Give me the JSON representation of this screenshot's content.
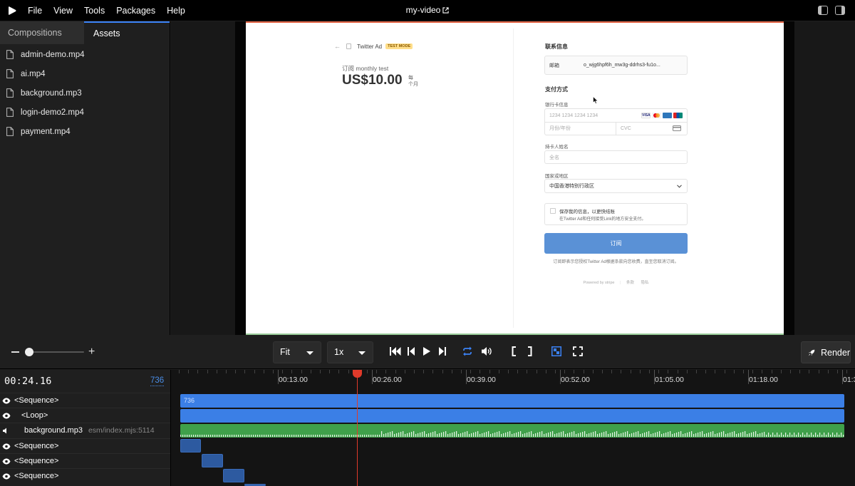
{
  "menubar": {
    "items": [
      "File",
      "View",
      "Tools",
      "Packages",
      "Help"
    ],
    "title": "my-video"
  },
  "sidebar": {
    "tabs": [
      "Compositions",
      "Assets"
    ],
    "assets": [
      "admin-demo.mp4",
      "ai.mp4",
      "background.mp3",
      "login-demo2.mp4",
      "payment.mp4"
    ]
  },
  "preview": {
    "merchant": "Twitter Ad",
    "badge": "TEST MODE",
    "subscription_label": "订阅 monthly test",
    "price": "US$10.00",
    "per_line1": "每",
    "per_line2": "个月",
    "contact_heading": "联系信息",
    "email_label": "邮箱",
    "email_value": "o_wjg6hpf6h_mw3g-ddrhs3-fu1o...",
    "payment_heading": "支付方式",
    "card_info_label": "银行卡信息",
    "card_number_placeholder": "1234 1234 1234 1234",
    "expiry_placeholder": "月份/年份",
    "cvc_placeholder": "CVC",
    "cardholder_label": "持卡人姓名",
    "cardholder_placeholder": "全名",
    "country_label": "国家或地区",
    "country_value": "中国香港特别行政区",
    "save_info_title": "保存我的信息，以更快结账",
    "save_info_desc": "在Twitter Ad和任何接受Link的地方安全支付。",
    "subscribe_button": "订阅",
    "terms_text": "订阅即表示您授权Twitter Ad根据条款向您收费，直至您取消订阅。",
    "powered_by": "Powered by stripe",
    "footer_terms": "条款",
    "footer_privacy": "隐私"
  },
  "controls": {
    "fit_value": "Fit",
    "speed_value": "1x",
    "render_label": "Render",
    "zoom_level": 0.0
  },
  "timeline": {
    "current_time": "00:24.16",
    "frame": "736",
    "ruler_labels": [
      "00:13.00",
      "00:26.00",
      "00:39.00",
      "00:52.00",
      "01:05.00",
      "01:18.00",
      "01:3"
    ],
    "tracks": [
      {
        "label": "<Sequence>",
        "sub": "",
        "clip_label": "736"
      },
      {
        "label": "<Loop>",
        "sub": ""
      },
      {
        "label": "background.mp3",
        "sub": "esm/index.mjs:5114"
      },
      {
        "label": "<Sequence>",
        "sub": ""
      },
      {
        "label": "<Sequence>",
        "sub": ""
      },
      {
        "label": "<Sequence>",
        "sub": ""
      }
    ]
  },
  "colors": {
    "accent": "#3b82f6",
    "playhead": "#e03a2a",
    "audio_clip": "#3fa04a",
    "sequence_clip": "#3b7fe6"
  }
}
